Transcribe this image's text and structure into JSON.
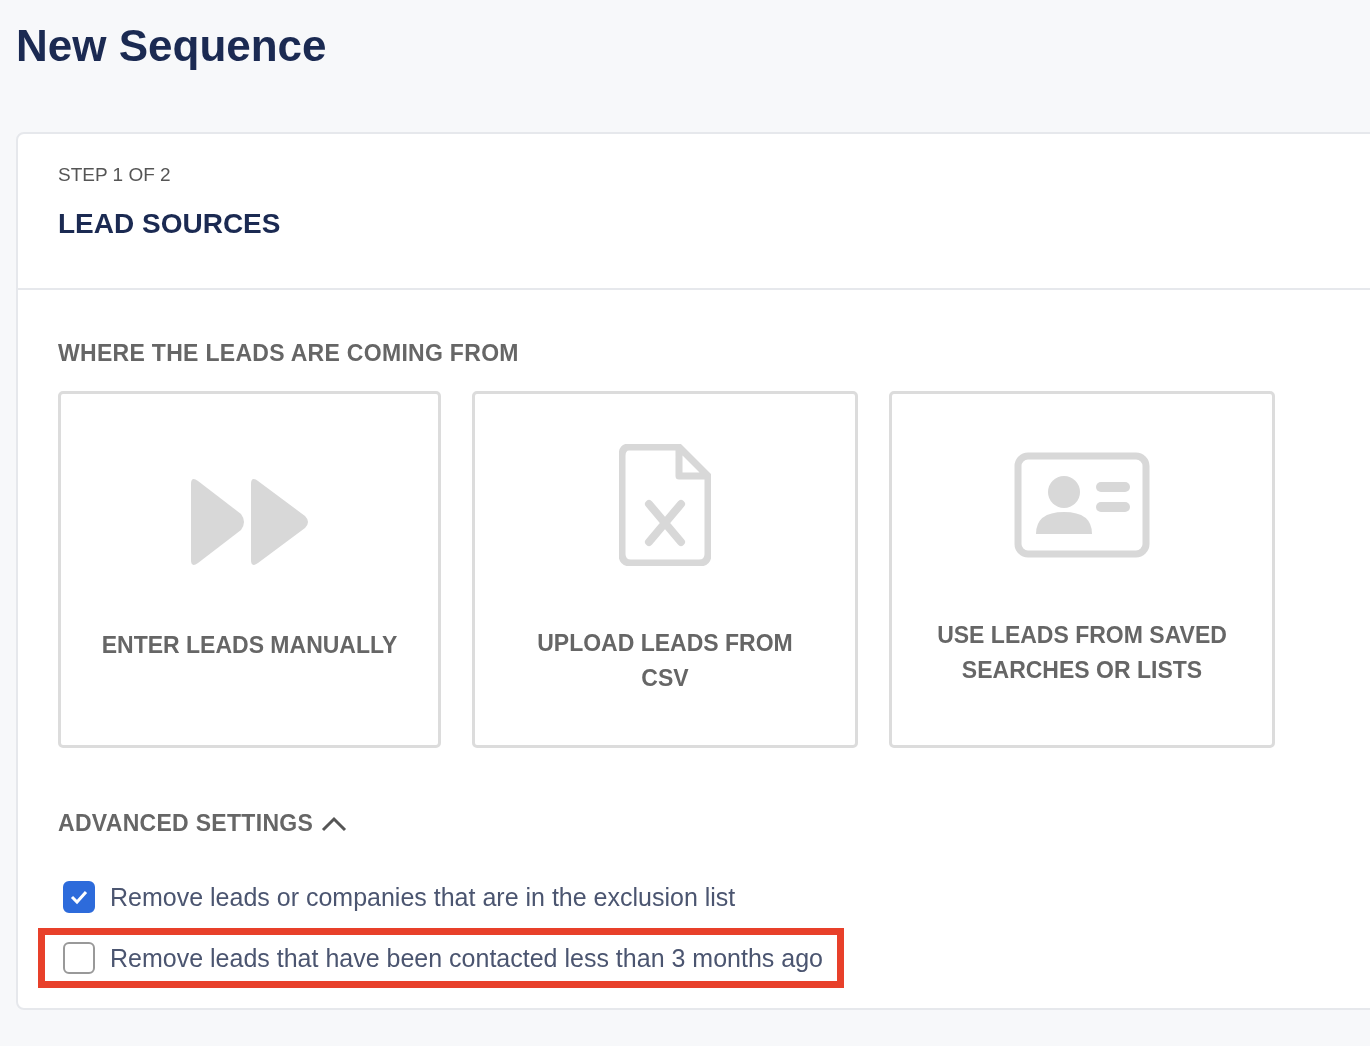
{
  "page": {
    "title": "New Sequence"
  },
  "step": {
    "label": "STEP 1 OF 2",
    "title": "LEAD SOURCES"
  },
  "sources": {
    "heading": "WHERE THE LEADS ARE COMING FROM",
    "options": [
      {
        "kind": "manual",
        "label": "ENTER LEADS MANUALLY",
        "selected": false
      },
      {
        "kind": "csv",
        "label": "UPLOAD LEADS FROM CSV",
        "selected": false
      },
      {
        "kind": "lists",
        "label": "USE LEADS FROM SAVED SEARCHES OR LISTS",
        "selected": false
      }
    ]
  },
  "advanced": {
    "label": "ADVANCED SETTINGS",
    "expanded": true,
    "options": [
      {
        "label": "Remove leads or companies that are in the exclusion list",
        "checked": true,
        "highlighted": false
      },
      {
        "label": "Remove leads that have been contacted less than 3 months ago",
        "checked": false,
        "highlighted": true
      }
    ]
  }
}
